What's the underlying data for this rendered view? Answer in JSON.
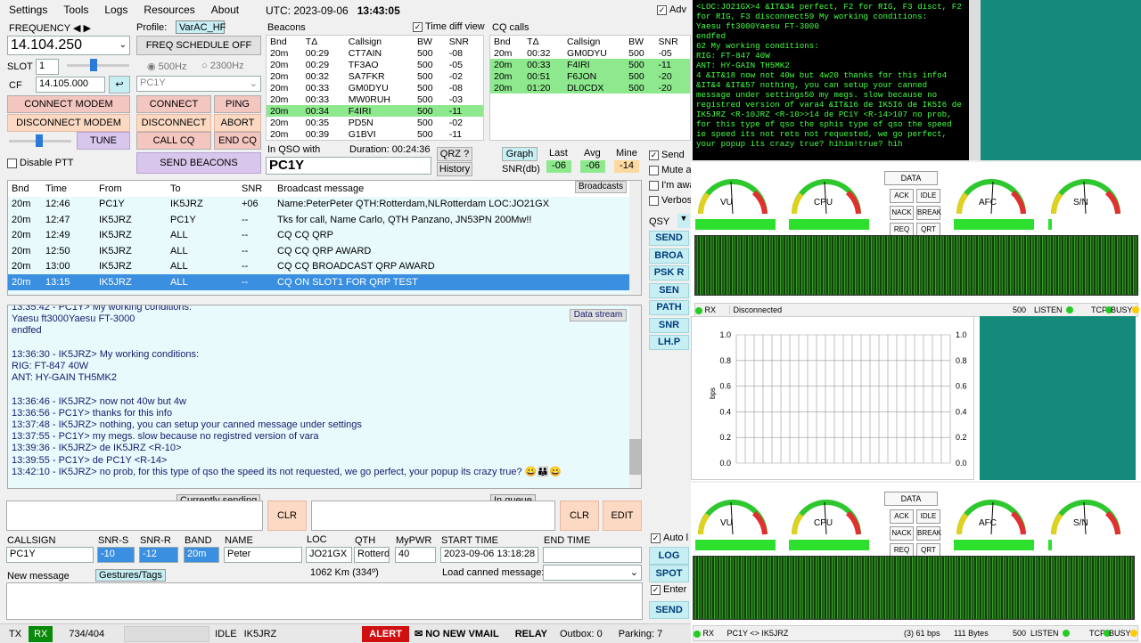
{
  "menu": [
    "Settings",
    "Tools",
    "Logs",
    "Resources",
    "About"
  ],
  "utc_label": "UTC: 2023-09-06",
  "utc_time": "13:43:05",
  "adv_label": "Adv",
  "frequency_label": "FREQUENCY",
  "frequency": "14.104.250",
  "profile_label": "Profile:",
  "profile": "VarAC_HF",
  "freq_schedule": "FREQ SCHEDULE OFF",
  "slot_label": "SLOT",
  "slot": "1",
  "bw500": "500Hz",
  "bw2300": "2300Hz",
  "cf_label": "CF",
  "cf": "14.105.000",
  "callsign_combo": "PC1Y",
  "btn": {
    "connect_modem": "CONNECT MODEM",
    "disconnect_modem": "DISCONNECT MODEM",
    "tune": "TUNE",
    "connect": "CONNECT",
    "ping": "PING",
    "disconnect": "DISCONNECT",
    "abort": "ABORT",
    "call_cq": "CALL CQ",
    "end_cq": "END CQ",
    "send_beacons": "SEND BEACONS",
    "disable_ptt": "Disable PTT"
  },
  "beacons": {
    "title": "Beacons",
    "time_diff": "Time diff view",
    "headers": [
      "Bnd",
      "TΔ",
      "Callsign",
      "BW",
      "SNR"
    ],
    "rows": [
      [
        "20m",
        "00:29",
        "CT7AIN",
        "500",
        "-08"
      ],
      [
        "20m",
        "00:29",
        "TF3AO",
        "500",
        "-05"
      ],
      [
        "20m",
        "00:32",
        "SA7FKR",
        "500",
        "-02"
      ],
      [
        "20m",
        "00:33",
        "GM0DYU",
        "500",
        "-08"
      ],
      [
        "20m",
        "00:33",
        "MW0RUH",
        "500",
        "-03"
      ],
      [
        "20m",
        "00:34",
        "F4IRI",
        "500",
        "-11"
      ],
      [
        "20m",
        "00:35",
        "PD5N",
        "500",
        "-02"
      ],
      [
        "20m",
        "00:39",
        "G1BVI",
        "500",
        "-11"
      ]
    ]
  },
  "cq": {
    "title": "CQ calls",
    "headers": [
      "Bnd",
      "TΔ",
      "Callsign",
      "BW",
      "SNR"
    ],
    "rows": [
      [
        "20m",
        "00:32",
        "GM0DYU",
        "500",
        "-05"
      ],
      [
        "20m",
        "00:33",
        "F4IRI",
        "500",
        "-11"
      ],
      [
        "20m",
        "00:51",
        "F6JON",
        "500",
        "-20"
      ],
      [
        "20m",
        "01:20",
        "DL0CDX",
        "500",
        "-20"
      ]
    ]
  },
  "inqso": {
    "label": "In QSO with",
    "duration": "Duration: 00:24:36",
    "callsign": "PC1Y",
    "qrz": "QRZ ?",
    "history": "History"
  },
  "snr": {
    "graph": "Graph",
    "last_l": "Last",
    "avg_l": "Avg",
    "mine_l": "Mine",
    "label": "SNR(db)",
    "last": "-06",
    "avg": "-06",
    "mine": "-14"
  },
  "opts": {
    "send": "Send",
    "mute": "Mute a",
    "away": "I'm awa",
    "verbose": "Verbos",
    "qsy": "QSY"
  },
  "bcast": {
    "headers": [
      "Bnd",
      "Time",
      "From",
      "To",
      "SNR",
      "Broadcast message"
    ],
    "btn": "Broadcasts",
    "rows": [
      [
        "20m",
        "12:46",
        "PC1Y",
        "IK5JRZ",
        "+06",
        "Name:PeterPeter QTH:Rotterdam,NLRotterdam  LOC:JO21GX"
      ],
      [
        "20m",
        "12:47",
        "IK5JRZ",
        "PC1Y",
        "--",
        "Tks for call, Name Carlo, QTH Panzano, JN53PN 200Mw!!"
      ],
      [
        "20m",
        "12:49",
        "IK5JRZ",
        "ALL",
        "--",
        "CQ CQ QRP"
      ],
      [
        "20m",
        "12:50",
        "IK5JRZ",
        "ALL",
        "--",
        "CQ CQ QRP AWARD"
      ],
      [
        "20m",
        "13:00",
        "IK5JRZ",
        "ALL",
        "--",
        "CQ CQ BROADCAST QRP AWARD"
      ],
      [
        "20m",
        "13:15",
        "IK5JRZ",
        "ALL",
        "--",
        "CQ ON SLOT1 FOR QRP TEST"
      ]
    ]
  },
  "side_btns": [
    "SEND",
    "BROA",
    "PSK R",
    "SEN",
    "PATH",
    "SNR",
    "LH.P"
  ],
  "chat": {
    "btn": "Data stream",
    "lines": [
      "13:35:42 - PC1Y> My working conditions:",
      "Yaesu ft3000Yaesu FT-3000",
      "endfed",
      "",
      "13:36:30 - IK5JRZ> My working conditions:",
      "RIG: FT-847 40W",
      "ANT: HY-GAIN TH5MK2",
      "",
      "13:36:46 - IK5JRZ> now not 40w but 4w",
      "13:36:56 - PC1Y> thanks for this info",
      "13:37:48 - IK5JRZ> nothing, you can setup your canned message under settings",
      "13:37:55 - PC1Y> my megs. slow because no registred version of vara",
      "13:39:36 - IK5JRZ> de IK5JRZ <R-10>",
      "13:39:55 - PC1Y> de PC1Y <R-14>",
      "13:42:10 - IK5JRZ> no prob, for this type of qso the speed its not requested, we go perfect, your popup its crazy true? 😀👪😀"
    ]
  },
  "sending": {
    "label": "Currently sending",
    "clr": "CLR",
    "queue": "In queue",
    "clr2": "CLR",
    "edit": "EDIT"
  },
  "log": {
    "callsign_l": "CALLSIGN",
    "snrs_l": "SNR-S",
    "snrr_l": "SNR-R",
    "band_l": "BAND",
    "name_l": "NAME",
    "loc_l": "LOC",
    "qth_l": "QTH",
    "pwr_l": "MyPWR",
    "start_l": "START TIME",
    "end_l": "END TIME",
    "callsign": "PC1Y",
    "snrs": "-10",
    "snrr": "-12",
    "band": "20m",
    "name": "Peter",
    "loc": "JO21GX",
    "qth": "Rotterda",
    "pwr": "40",
    "start": "2023-09-06 13:18:28",
    "end": "",
    "dist": "1062 Km (334º)",
    "autolog": "Auto l",
    "log_btn": "LOG",
    "spot_btn": "SPOT"
  },
  "newmsg": {
    "label": "New message",
    "gestures": "Gestures/Tags",
    "canned": "Load canned message:",
    "enter": "Enter",
    "send": "SEND"
  },
  "status": {
    "tx": "TX",
    "rx": "RX",
    "count": "734/404",
    "idle": "IDLE",
    "call": "IK5JRZ",
    "alert": "ALERT",
    "vmail": "✉ NO NEW VMAIL",
    "relay": "RELAY",
    "outbox": "Outbox: 0",
    "parking": "Parking: 7"
  },
  "terminal": "<LOC:JO21GX>4 &IT&34 perfect, F2 for RIG, F3 disct, F2\nfor RIG, F3 disconnect59 My working conditions:\nYaesu ft3000Yaesu FT-3000\nendfed\n62 My working conditions:\nRIG: FT-847 40W\nANT: HY-GAIN TH5MK2\n4 &IT&18 now not 40w but 4w20 thanks for this info4\n&IT&4 &IT&57 nothing, you can setup your canned\nmessage under settings50 my megs. slow because no\nregistred version of vara4 &IT&16 de IK5I6 de IK5I6 de\nIK5JRZ <R-10JRZ <R-10>>14 de PC1Y <R-14>107 no prob,\nfor this type of qso the sphis type of qso the speed\nie speed its not rets not requested, we go perfect,\nyour popup its crazy true? hihim!true? hih",
  "vara": {
    "gauges": [
      "VU",
      "CPU",
      "AFC",
      "S/N"
    ],
    "data": "DATA",
    "ctl": [
      "ACK",
      "IDLE",
      "NACK",
      "BREAK",
      "REQ",
      "QRT"
    ],
    "rx": "RX",
    "disc": "Disconnected",
    "bw": "500",
    "listen": "LISTEN",
    "tcp": "TCP",
    "busy": "BUSY",
    "bps": "bps",
    "yticks": [
      "1.0",
      "0.8",
      "0.6",
      "0.4",
      "0.2",
      "0.0"
    ],
    "rx2": "RX",
    "link": "PC1Y <> IK5JRZ",
    "rate": "(3) 61 bps",
    "bytes": "111 Bytes"
  }
}
